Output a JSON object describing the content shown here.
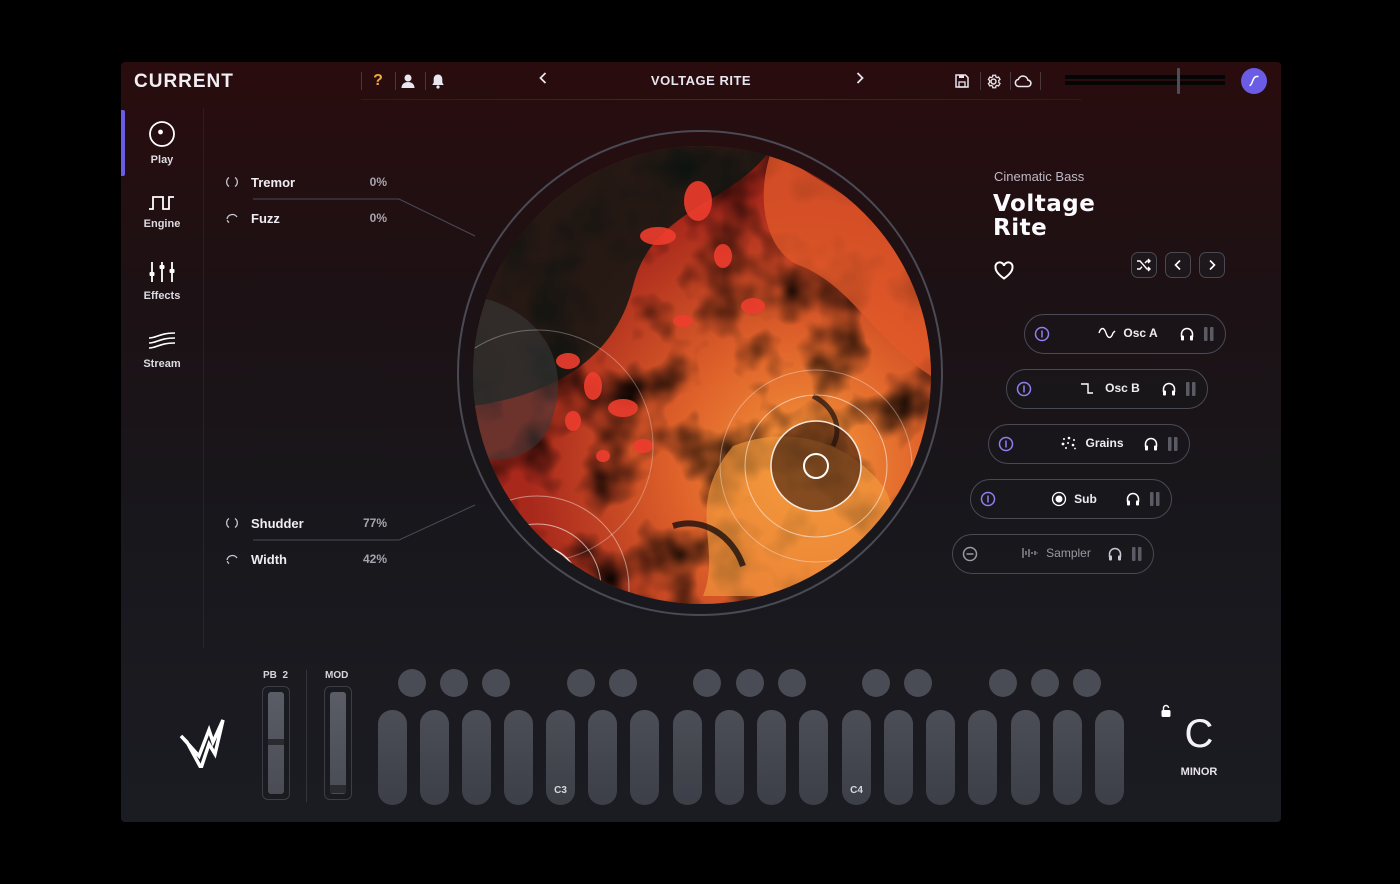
{
  "app": {
    "brand": "CURRENT",
    "help_glyph": "?"
  },
  "preset": {
    "name": "VOLTAGE RITE",
    "category": "Cinematic Bass",
    "title_line1": "Voltage",
    "title_line2": "Rite"
  },
  "sidebar": {
    "items": [
      {
        "label": "Play",
        "icon": "play-dial-icon",
        "active": true
      },
      {
        "label": "Engine",
        "icon": "square-wave-icon"
      },
      {
        "label": "Effects",
        "icon": "sliders-icon"
      },
      {
        "label": "Stream",
        "icon": "stream-waves-icon"
      }
    ]
  },
  "macros": {
    "top": [
      {
        "name": "Tremor",
        "value": "0%"
      },
      {
        "name": "Fuzz",
        "value": "0%"
      }
    ],
    "bottom": [
      {
        "name": "Shudder",
        "value": "77%"
      },
      {
        "name": "Width",
        "value": "42%"
      }
    ]
  },
  "layers": [
    {
      "name": "Osc A",
      "icon": "sine-wave-icon",
      "enabled": true
    },
    {
      "name": "Osc B",
      "icon": "square-wave-icon",
      "enabled": true
    },
    {
      "name": "Grains",
      "icon": "grains-icon",
      "enabled": true
    },
    {
      "name": "Sub",
      "icon": "sub-icon",
      "enabled": true
    },
    {
      "name": "Sampler",
      "icon": "waveform-icon",
      "enabled": false
    }
  ],
  "performance": {
    "pitch_bend_label": "PB",
    "pitch_bend_range": "2",
    "mod_label": "MOD",
    "note_labels": {
      "c3": "C3",
      "c4": "C4"
    }
  },
  "key": {
    "root": "C",
    "scale": "MINOR"
  },
  "colors": {
    "accent": "#6b5ce6",
    "help": "#f2a93b"
  }
}
